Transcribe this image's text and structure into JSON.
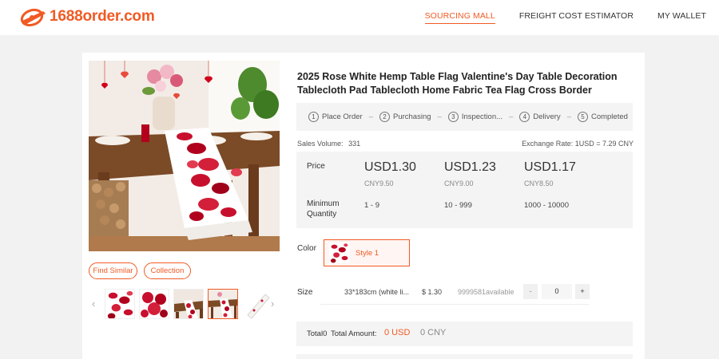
{
  "header": {
    "brand": "1688order.com",
    "nav": [
      "SOURCING MALL",
      "FREIGHT COST ESTIMATOR",
      "MY WALLET"
    ],
    "accent_color": "#f15a24"
  },
  "product": {
    "title": "2025 Rose White Hemp Table Flag Valentine's Day Table Decoration Tablecloth Pad Tablecloth Home Fabric Tea Flag Cross Border",
    "find_similar": "Find Similar",
    "collection": "Collection"
  },
  "steps": [
    {
      "num": "1",
      "label": "Place Order"
    },
    {
      "num": "2",
      "label": "Purchasing"
    },
    {
      "num": "3",
      "label": "Inspection..."
    },
    {
      "num": "4",
      "label": "Delivery"
    },
    {
      "num": "5",
      "label": "Completed"
    }
  ],
  "stats": {
    "sales_label": "Sales Volume:",
    "sales_value": "331",
    "exchange_rate": "Exchange Rate: 1USD = 7.29 CNY"
  },
  "pricing": {
    "price_label": "Price",
    "min_qty_label_1": "Minimum",
    "min_qty_label_2": "Quantity",
    "tiers": [
      {
        "usd": "USD1.30",
        "cny": "CNY9.50",
        "range": "1 - 9"
      },
      {
        "usd": "USD1.23",
        "cny": "CNY9.00",
        "range": "10 - 999"
      },
      {
        "usd": "USD1.17",
        "cny": "CNY8.50",
        "range": "1000 - 10000"
      }
    ]
  },
  "options": {
    "color_label": "Color",
    "style_label": "Style 1",
    "size_label": "Size",
    "size_name": "33*183cm (white li...",
    "size_price": "$ 1.30",
    "size_stock": "9999581available",
    "qty_minus": "-",
    "qty_value": "0",
    "qty_plus": "+"
  },
  "total": {
    "count": "Total0",
    "amount_label": "Total Amount:",
    "usd": "0 USD",
    "cny": "0 CNY"
  }
}
